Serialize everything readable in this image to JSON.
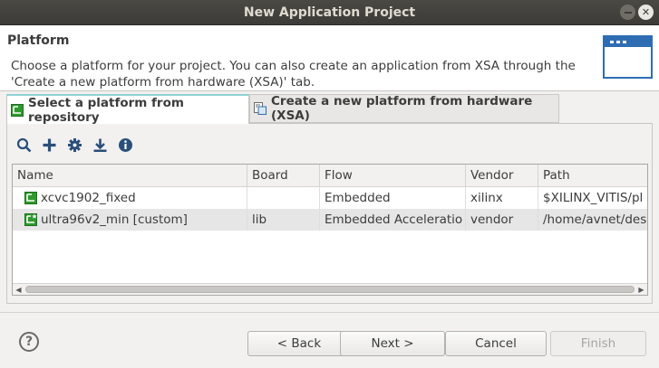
{
  "window": {
    "title": "New Application Project"
  },
  "header": {
    "title": "Platform",
    "description": "Choose a platform for your project. You can also create an application from XSA through the 'Create a new platform from hardware (XSA)' tab."
  },
  "tabs": [
    {
      "label": "Select a platform from repository",
      "active": true
    },
    {
      "label": "Create a new platform from hardware (XSA)",
      "active": false
    }
  ],
  "toolbar": {
    "icons": [
      "search-icon",
      "add-icon",
      "gear-icon",
      "download-icon",
      "info-icon"
    ]
  },
  "table": {
    "columns": [
      "Name",
      "Board",
      "Flow",
      "Vendor",
      "Path"
    ],
    "rows": [
      {
        "name": "xcvc1902_fixed",
        "board": "",
        "flow": "Embedded",
        "vendor": "xilinx",
        "path": "$XILINX_VITIS/pl",
        "selected": false
      },
      {
        "name": "ultra96v2_min [custom]",
        "board": "lib",
        "flow": "Embedded Acceleratio",
        "vendor": "vendor",
        "path": "/home/avnet/des",
        "selected": true
      }
    ]
  },
  "buttons": {
    "help": "?",
    "back": "< Back",
    "next": "Next >",
    "cancel": "Cancel",
    "finish": "Finish"
  },
  "colors": {
    "accent": "#2f6db3",
    "platform_icon": "#2e9a2e",
    "tab_highlight": "#8fd3d3"
  }
}
